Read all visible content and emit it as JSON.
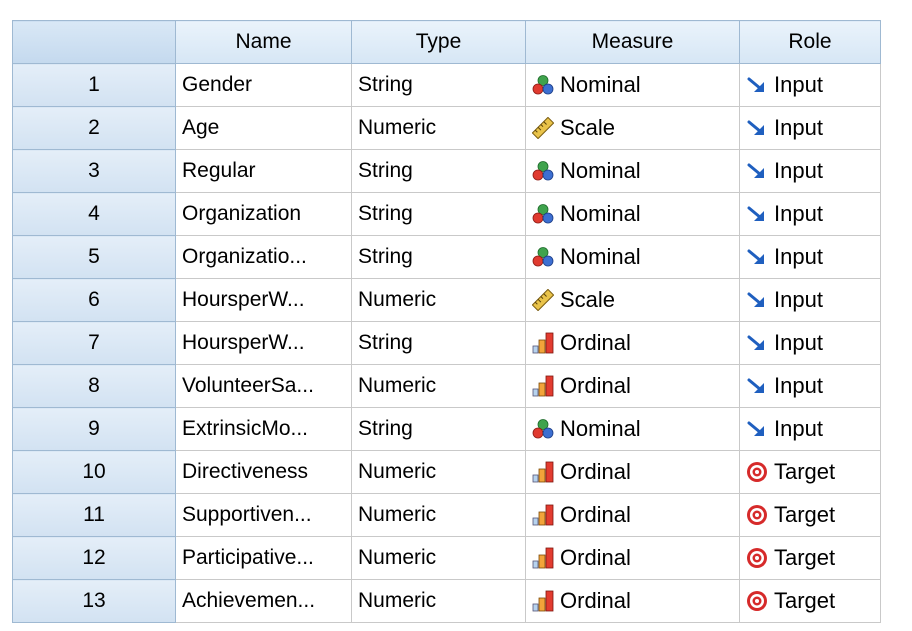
{
  "columns": [
    "",
    "Name",
    "Type",
    "Measure",
    "Role"
  ],
  "rows": [
    {
      "num": "1",
      "name": "Gender",
      "type": "String",
      "measure": "Nominal",
      "measure_icon": "nominal-icon",
      "role": "Input",
      "role_icon": "input-arrow-icon"
    },
    {
      "num": "2",
      "name": "Age",
      "type": "Numeric",
      "measure": "Scale",
      "measure_icon": "scale-ruler-icon",
      "role": "Input",
      "role_icon": "input-arrow-icon"
    },
    {
      "num": "3",
      "name": "Regular",
      "type": "String",
      "measure": "Nominal",
      "measure_icon": "nominal-icon",
      "role": "Input",
      "role_icon": "input-arrow-icon"
    },
    {
      "num": "4",
      "name": "Organization",
      "type": "String",
      "measure": "Nominal",
      "measure_icon": "nominal-icon",
      "role": "Input",
      "role_icon": "input-arrow-icon"
    },
    {
      "num": "5",
      "name": "Organizatio...",
      "type": "String",
      "measure": "Nominal",
      "measure_icon": "nominal-icon",
      "role": "Input",
      "role_icon": "input-arrow-icon"
    },
    {
      "num": "6",
      "name": "HoursperW...",
      "type": "Numeric",
      "measure": "Scale",
      "measure_icon": "scale-ruler-icon",
      "role": "Input",
      "role_icon": "input-arrow-icon"
    },
    {
      "num": "7",
      "name": "HoursperW...",
      "type": "String",
      "measure": "Ordinal",
      "measure_icon": "ordinal-bars-icon",
      "role": "Input",
      "role_icon": "input-arrow-icon"
    },
    {
      "num": "8",
      "name": "VolunteerSa...",
      "type": "Numeric",
      "measure": "Ordinal",
      "measure_icon": "ordinal-bars-icon",
      "role": "Input",
      "role_icon": "input-arrow-icon"
    },
    {
      "num": "9",
      "name": "ExtrinsicMo...",
      "type": "String",
      "measure": "Nominal",
      "measure_icon": "nominal-icon",
      "role": "Input",
      "role_icon": "input-arrow-icon"
    },
    {
      "num": "10",
      "name": "Directiveness",
      "type": "Numeric",
      "measure": "Ordinal",
      "measure_icon": "ordinal-bars-icon",
      "role": "Target",
      "role_icon": "target-icon"
    },
    {
      "num": "11",
      "name": "Supportiven...",
      "type": "Numeric",
      "measure": "Ordinal",
      "measure_icon": "ordinal-bars-icon",
      "role": "Target",
      "role_icon": "target-icon"
    },
    {
      "num": "12",
      "name": "Participative...",
      "type": "Numeric",
      "measure": "Ordinal",
      "measure_icon": "ordinal-bars-icon",
      "role": "Target",
      "role_icon": "target-icon"
    },
    {
      "num": "13",
      "name": "Achievemen...",
      "type": "Numeric",
      "measure": "Ordinal",
      "measure_icon": "ordinal-bars-icon",
      "role": "Target",
      "role_icon": "target-icon"
    }
  ]
}
